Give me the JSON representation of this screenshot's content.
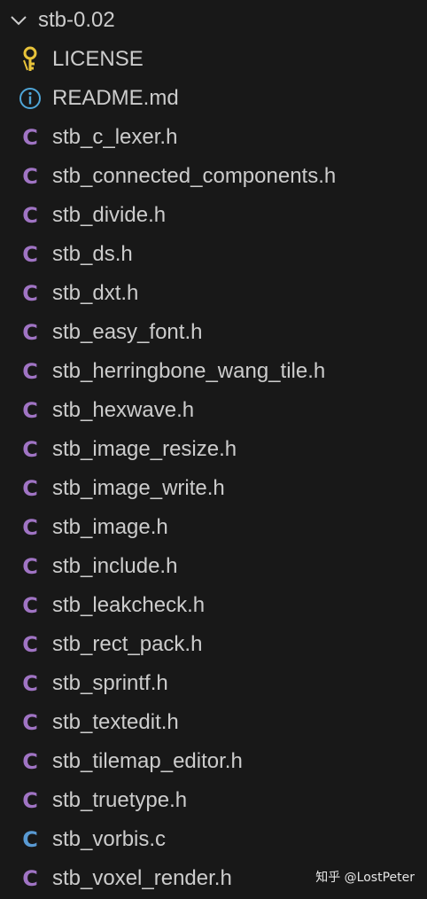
{
  "folder": {
    "name": "stb-0.02",
    "icon": "chevron-down-icon"
  },
  "files": [
    {
      "name": "LICENSE",
      "icon": "license-key-icon",
      "color": "#e8c33a"
    },
    {
      "name": "README.md",
      "icon": "info-icon",
      "color": "#4fa6d8"
    },
    {
      "name": "stb_c_lexer.h",
      "icon": "c-header-icon",
      "color": "#a074c4"
    },
    {
      "name": "stb_connected_components.h",
      "icon": "c-header-icon",
      "color": "#a074c4"
    },
    {
      "name": "stb_divide.h",
      "icon": "c-header-icon",
      "color": "#a074c4"
    },
    {
      "name": "stb_ds.h",
      "icon": "c-header-icon",
      "color": "#a074c4"
    },
    {
      "name": "stb_dxt.h",
      "icon": "c-header-icon",
      "color": "#a074c4"
    },
    {
      "name": "stb_easy_font.h",
      "icon": "c-header-icon",
      "color": "#a074c4"
    },
    {
      "name": "stb_herringbone_wang_tile.h",
      "icon": "c-header-icon",
      "color": "#a074c4"
    },
    {
      "name": "stb_hexwave.h",
      "icon": "c-header-icon",
      "color": "#a074c4"
    },
    {
      "name": "stb_image_resize.h",
      "icon": "c-header-icon",
      "color": "#a074c4"
    },
    {
      "name": "stb_image_write.h",
      "icon": "c-header-icon",
      "color": "#a074c4"
    },
    {
      "name": "stb_image.h",
      "icon": "c-header-icon",
      "color": "#a074c4"
    },
    {
      "name": "stb_include.h",
      "icon": "c-header-icon",
      "color": "#a074c4"
    },
    {
      "name": "stb_leakcheck.h",
      "icon": "c-header-icon",
      "color": "#a074c4"
    },
    {
      "name": "stb_rect_pack.h",
      "icon": "c-header-icon",
      "color": "#a074c4"
    },
    {
      "name": "stb_sprintf.h",
      "icon": "c-header-icon",
      "color": "#a074c4"
    },
    {
      "name": "stb_textedit.h",
      "icon": "c-header-icon",
      "color": "#a074c4"
    },
    {
      "name": "stb_tilemap_editor.h",
      "icon": "c-header-icon",
      "color": "#a074c4"
    },
    {
      "name": "stb_truetype.h",
      "icon": "c-header-icon",
      "color": "#a074c4"
    },
    {
      "name": "stb_vorbis.c",
      "icon": "c-source-icon",
      "color": "#599ad3"
    },
    {
      "name": "stb_voxel_render.h",
      "icon": "c-header-icon",
      "color": "#a074c4"
    }
  ],
  "watermark": "知乎 @LostPeter"
}
